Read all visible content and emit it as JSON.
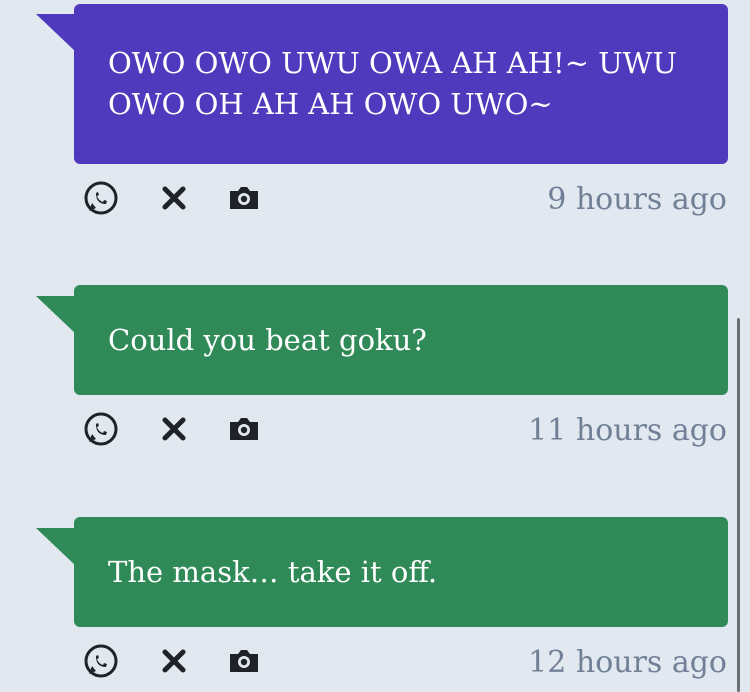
{
  "colors": {
    "background": "#e2e8f0",
    "bubble_purple": "#4f39bd",
    "bubble_green": "#2f8a57",
    "timestamp": "#718096",
    "icon": "#1f2328"
  },
  "messages": [
    {
      "text": "OWO OWO UWU OWA AH AH!~ UWU OWO OH AH AH OWO UWO~",
      "timestamp": "9 hours ago",
      "color": "#4f39bd"
    },
    {
      "text": "Could you beat goku?",
      "timestamp": "11 hours ago",
      "color": "#2f8a57"
    },
    {
      "text": "The mask… take it off.",
      "timestamp": "12 hours ago",
      "color": "#2f8a57"
    }
  ],
  "actions": {
    "icons": [
      "whatsapp-icon",
      "close-icon",
      "camera-icon"
    ]
  }
}
